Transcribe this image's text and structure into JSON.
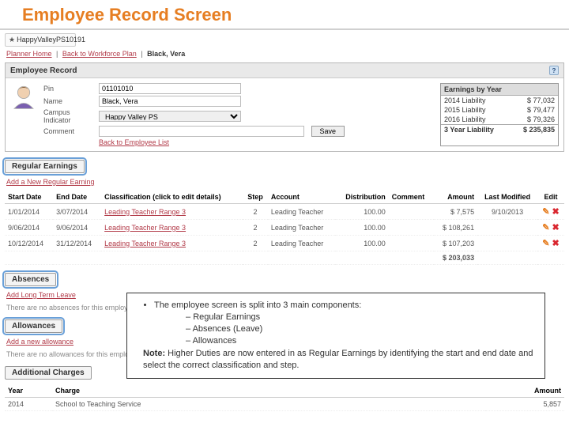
{
  "slide_title": "Employee Record Screen",
  "campus_selector": "HappyValleyPS10191",
  "breadcrumb": {
    "home": "Planner Home",
    "back": "Back to Workforce Plan",
    "current": "Black, Vera"
  },
  "panel_title": "Employee Record",
  "fields": {
    "pin_label": "Pin",
    "pin_value": "01101010",
    "name_label": "Name",
    "name_value": "Black, Vera",
    "campus_label": "Campus Indicator",
    "campus_value": "Happy Valley PS",
    "comment_label": "Comment",
    "comment_value": "",
    "save_label": "Save",
    "back_label": "Back to Employee List"
  },
  "earnings_box": {
    "header": "Earnings by Year",
    "rows": [
      {
        "label": "2014 Liability",
        "value": "$ 77,032"
      },
      {
        "label": "2015 Liability",
        "value": "$ 79,477"
      },
      {
        "label": "2016 Liability",
        "value": "$ 79,326"
      }
    ],
    "total_label": "3 Year Liability",
    "total_value": "$ 235,835"
  },
  "regular": {
    "tab": "Regular Earnings",
    "add_link": "Add a New Regular Earning",
    "headers": {
      "start": "Start Date",
      "end": "End Date",
      "class": "Classification (click to edit details)",
      "step": "Step",
      "account": "Account",
      "dist": "Distribution",
      "comment": "Comment",
      "amount": "Amount",
      "modified": "Last Modified",
      "edit": "Edit"
    },
    "rows": [
      {
        "start": "1/01/2014",
        "end": "3/07/2014",
        "class": "Leading Teacher Range 3",
        "step": "2",
        "account": "Leading Teacher",
        "dist": "100.00",
        "comment": "",
        "amount": "$ 7,575",
        "modified": "9/10/2013"
      },
      {
        "start": "9/06/2014",
        "end": "9/06/2014",
        "class": "Leading Teacher Range 3",
        "step": "2",
        "account": "Leading Teacher",
        "dist": "100.00",
        "comment": "",
        "amount": "$ 108,261",
        "modified": ""
      },
      {
        "start": "10/12/2014",
        "end": "31/12/2014",
        "class": "Leading Teacher Range 3",
        "step": "2",
        "account": "Leading Teacher",
        "dist": "100.00",
        "comment": "",
        "amount": "$ 107,203",
        "modified": ""
      }
    ],
    "total": "$ 203,033"
  },
  "absences": {
    "tab": "Absences",
    "add_link": "Add Long Term Leave",
    "empty": "There are no absences for this employee."
  },
  "allowances": {
    "tab": "Allowances",
    "add_link": "Add a new allowance",
    "empty": "There are no allowances for this employee."
  },
  "charges": {
    "tab": "Additional Charges",
    "headers": {
      "year": "Year",
      "charge": "Charge",
      "amount": "Amount"
    },
    "row": {
      "year": "2014",
      "charge": "School to Teaching Service",
      "amount": "5,857"
    }
  },
  "callout": {
    "line1": "The employee screen is split into 3 main components:",
    "b1": "Regular Earnings",
    "b2": "Absences (Leave)",
    "b3": "Allowances",
    "note_label": "Note:",
    "note_text": " Higher Duties are now entered in as Regular Earnings by identifying the start and end date and select the correct classification and step."
  }
}
